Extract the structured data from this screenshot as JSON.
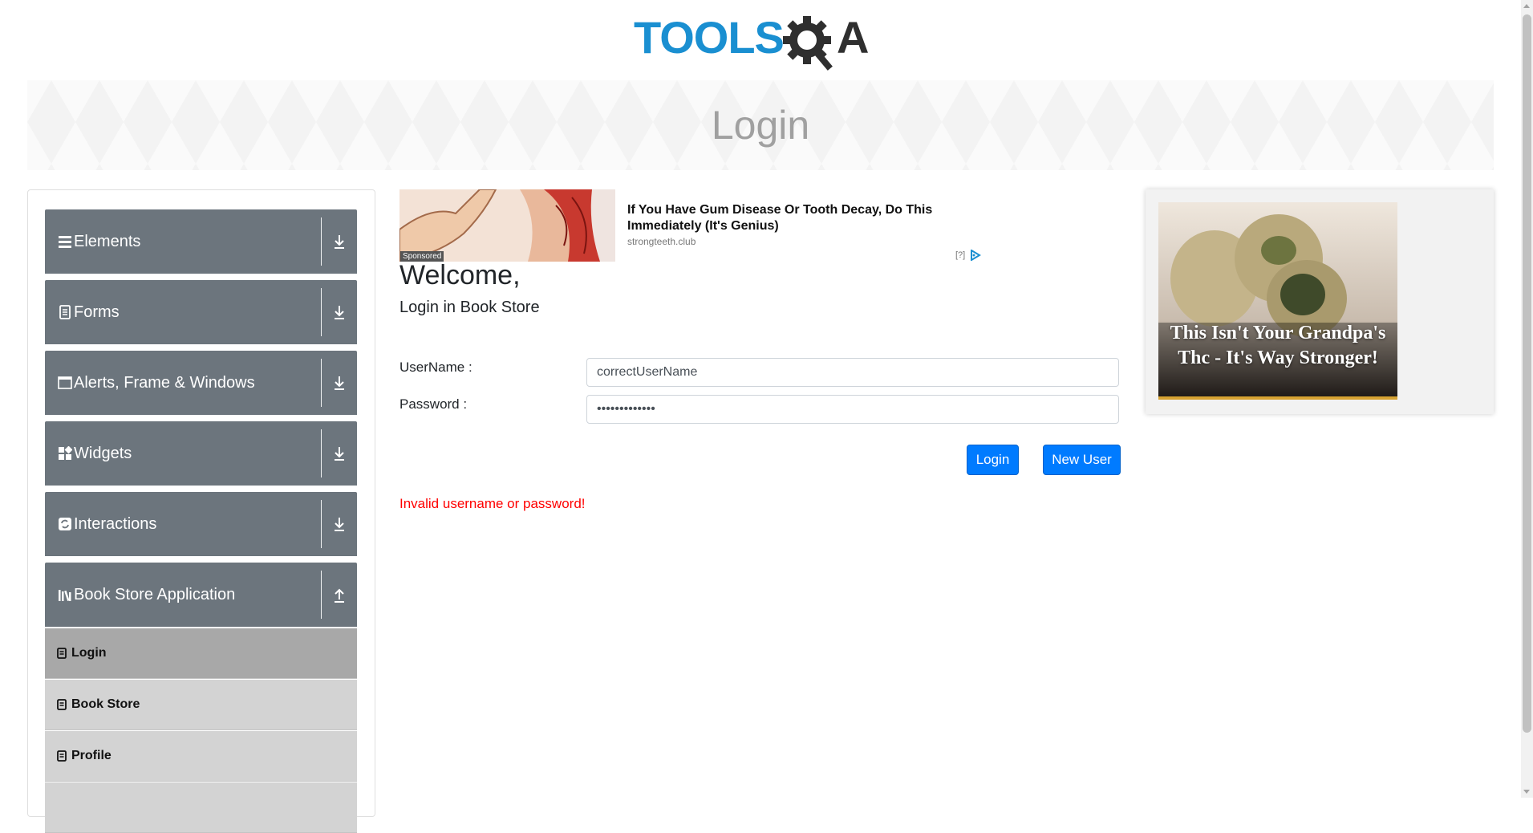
{
  "header": {
    "logo_text_left": "TOOLS",
    "logo_text_right": "A",
    "page_title": "Login"
  },
  "sidebar": {
    "groups": [
      {
        "label": "Elements",
        "icon": "hamburger-icon",
        "arrow": "download-arrow-icon"
      },
      {
        "label": "Forms",
        "icon": "document-icon",
        "arrow": "download-arrow-icon"
      },
      {
        "label": "Alerts, Frame & Windows",
        "icon": "window-icon",
        "arrow": "download-arrow-icon"
      },
      {
        "label": "Widgets",
        "icon": "widgets-icon",
        "arrow": "download-arrow-icon"
      },
      {
        "label": "Interactions",
        "icon": "interactions-icon",
        "arrow": "download-arrow-icon"
      },
      {
        "label": "Book Store Application",
        "icon": "books-icon",
        "arrow": "upload-arrow-icon"
      }
    ],
    "items": [
      {
        "label": "Login",
        "active": true
      },
      {
        "label": "Book Store",
        "active": false
      },
      {
        "label": "Profile",
        "active": false
      }
    ]
  },
  "ad_top": {
    "sponsored": "Sponsored",
    "title": "If You Have Gum Disease Or Tooth Decay, Do This Immediately (It's Genius)",
    "domain": "strongteeth.club",
    "adchoices": "[?]"
  },
  "main": {
    "welcome": "Welcome,",
    "subheading": "Login in Book Store",
    "username_label": "UserName :",
    "username_value": "correctUserName",
    "password_label": "Password :",
    "password_value": "incorrectPass",
    "login_button": "Login",
    "new_user_button": "New User",
    "error_message": "Invalid username or password!"
  },
  "ad_right": {
    "text": "This Isn't Your Grandpa's Thc - It's Way Stronger!"
  },
  "colors": {
    "menu_bg": "#6c757d",
    "sub_active": "#a8a8a8",
    "sub_bg": "#d3d3d3",
    "primary": "#007bff",
    "error": "#ff0000",
    "logo_blue": "#1a8fd1",
    "logo_dark": "#2f2f2f"
  }
}
